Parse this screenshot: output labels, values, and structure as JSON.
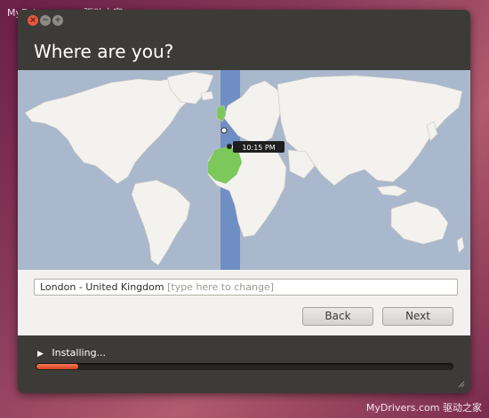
{
  "watermark": "MyDrivers.com 驱动之家",
  "window": {
    "close_glyph": "×",
    "min_glyph": "−",
    "max_glyph": "+"
  },
  "page_title": "Where are you?",
  "map": {
    "time_label": "10:15 PM",
    "icon": "world-map",
    "colors": {
      "ocean": "#a9b8cc",
      "land": "#f3f2ef",
      "timezone_band": "#6f8fc4",
      "selected_region": "#7cc85a"
    }
  },
  "location": {
    "value": "London - United Kingdom",
    "hint": "[type here to change]"
  },
  "buttons": {
    "back": "Back",
    "next": "Next"
  },
  "install": {
    "arrow": "▶",
    "label": "Installing...",
    "progress": 0.1,
    "progress_color": "#e4573d"
  }
}
